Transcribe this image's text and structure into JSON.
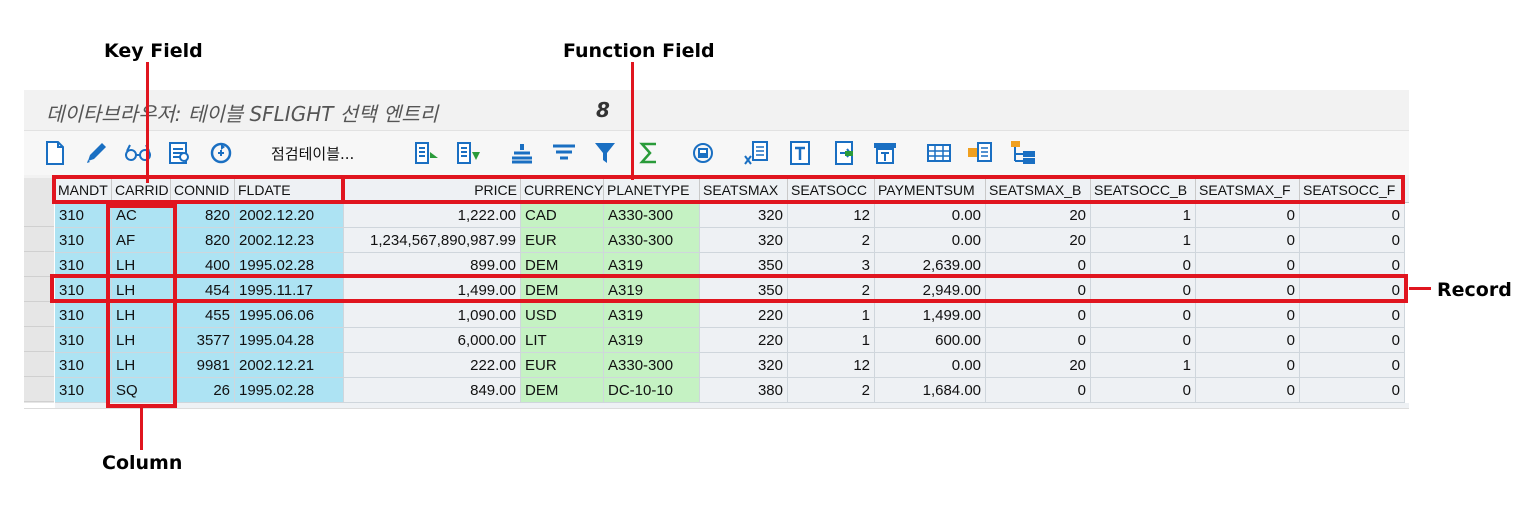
{
  "annotations": {
    "key_field": "Key Field",
    "function_field": "Function Field",
    "record": "Record",
    "column": "Column"
  },
  "window": {
    "title": "데이타브라우저: 테이블 SFLIGHT 선택 엔트리",
    "count": "8"
  },
  "toolbar": {
    "check_table_label": "점검테이블...",
    "icons": [
      "new-icon",
      "edit-icon",
      "glasses-icon",
      "detail-icon",
      "refresh-icon",
      "sort-asc-icon",
      "sort-desc-icon",
      "filter-set-icon",
      "filter-icon",
      "funnel-icon",
      "sum-icon",
      "print-icon",
      "excel-export-icon",
      "text-export-icon",
      "local-file-icon",
      "layout-icon",
      "table-icon",
      "config-icon",
      "hierarchy-icon"
    ]
  },
  "table": {
    "columns": [
      "MANDT",
      "CARRID",
      "CONNID",
      "FLDATE",
      "PRICE",
      "CURRENCY",
      "PLANETYPE",
      "SEATSMAX",
      "SEATSOCC",
      "PAYMENTSUM",
      "SEATSMAX_B",
      "SEATSOCC_B",
      "SEATSMAX_F",
      "SEATSOCC_F"
    ],
    "rows": [
      [
        "310",
        "AC",
        "820",
        "2002.12.20",
        "1,222.00",
        "CAD",
        "A330-300",
        "320",
        "12",
        "0.00",
        "20",
        "1",
        "0",
        "0"
      ],
      [
        "310",
        "AF",
        "820",
        "2002.12.23",
        "1,234,567,890,987.99",
        "EUR",
        "A330-300",
        "320",
        "2",
        "0.00",
        "20",
        "1",
        "0",
        "0"
      ],
      [
        "310",
        "LH",
        "400",
        "1995.02.28",
        "899.00",
        "DEM",
        "A319",
        "350",
        "3",
        "2,639.00",
        "0",
        "0",
        "0",
        "0"
      ],
      [
        "310",
        "LH",
        "454",
        "1995.11.17",
        "1,499.00",
        "DEM",
        "A319",
        "350",
        "2",
        "2,949.00",
        "0",
        "0",
        "0",
        "0"
      ],
      [
        "310",
        "LH",
        "455",
        "1995.06.06",
        "1,090.00",
        "USD",
        "A319",
        "220",
        "1",
        "1,499.00",
        "0",
        "0",
        "0",
        "0"
      ],
      [
        "310",
        "LH",
        "3577",
        "1995.04.28",
        "6,000.00",
        "LIT",
        "A319",
        "220",
        "1",
        "600.00",
        "0",
        "0",
        "0",
        "0"
      ],
      [
        "310",
        "LH",
        "9981",
        "2002.12.21",
        "222.00",
        "EUR",
        "A330-300",
        "320",
        "12",
        "0.00",
        "20",
        "1",
        "0",
        "0"
      ],
      [
        "310",
        "SQ",
        "26",
        "1995.02.28",
        "849.00",
        "DEM",
        "DC-10-10",
        "380",
        "2",
        "1,684.00",
        "0",
        "0",
        "0",
        "0"
      ]
    ]
  },
  "colors": {
    "key_field_bg": "#ade3f3",
    "currency_field_bg": "#c5f2c3",
    "annotation_red": "#e0151f"
  }
}
